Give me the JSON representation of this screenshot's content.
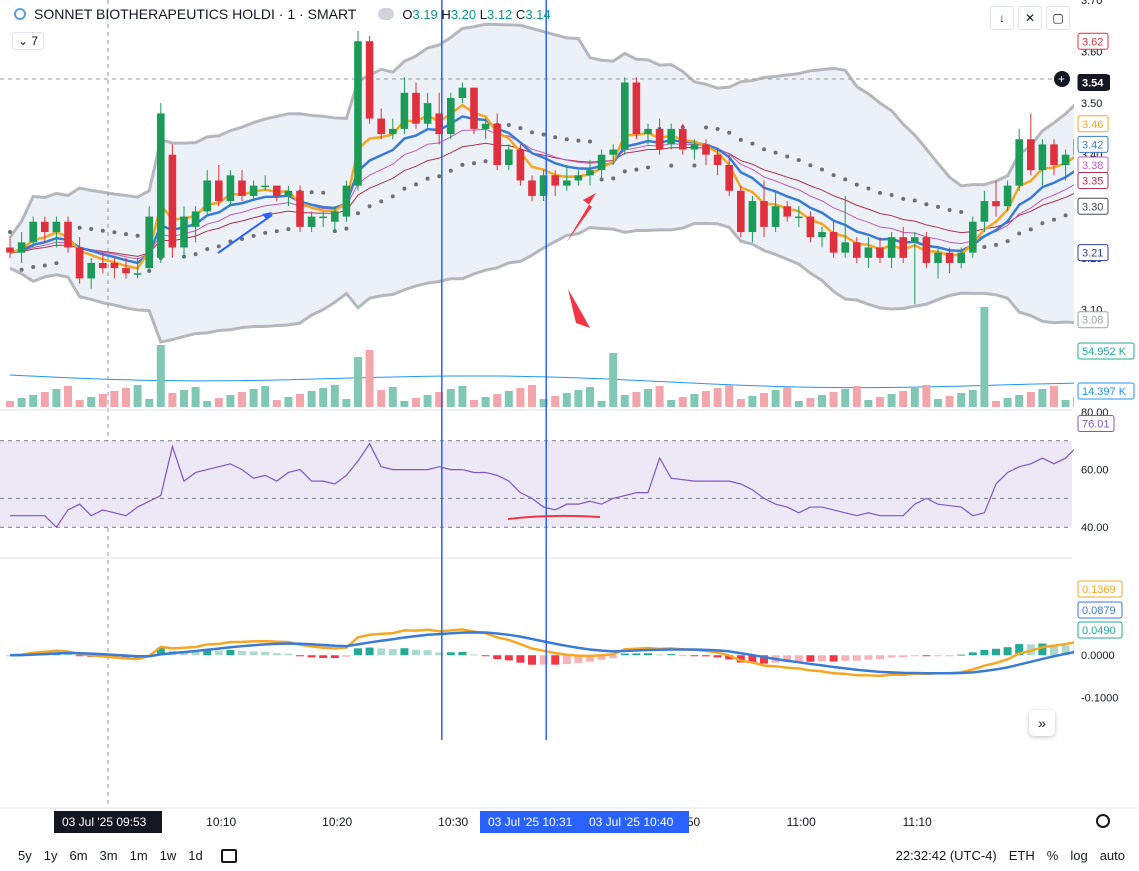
{
  "header": {
    "symbol": "SONNET BIOTHERAPEUTICS HOLDI",
    "interval": "1",
    "exchange": "SMART",
    "open_label": "O",
    "open": "3.19",
    "high_label": "H",
    "high": "3.20",
    "low_label": "L",
    "low": "3.12",
    "close_label": "C",
    "close": "3.14",
    "indicator_count": "7"
  },
  "toolbar": {
    "down_arrow_icon": "arrow-down-icon",
    "collapse_icon": "collapse-icon",
    "fullscreen_icon": "fullscreen-icon",
    "nav_icon": "double-chevron-right-icon"
  },
  "bottom_bar": {
    "ranges": [
      "5y",
      "1y",
      "6m",
      "3m",
      "1m",
      "1w",
      "1d"
    ],
    "time": "22:32:42 (UTC-4)",
    "session": "ETH",
    "percent": "%",
    "log": "log",
    "auto": "auto"
  },
  "chart_data": [
    {
      "type": "candlestick",
      "panel": "price",
      "ylim": [
        3.06,
        3.7
      ],
      "y_ticks": [
        "3.70",
        "3.60",
        "3.50",
        "3.40",
        "3.30",
        "3.20",
        "3.10"
      ],
      "x_ticks": [
        {
          "t": 7,
          "label": "10:00"
        },
        {
          "t": 17,
          "label": "10:10"
        },
        {
          "t": 27,
          "label": "10:20"
        },
        {
          "t": 37,
          "label": "10:30"
        },
        {
          "t": 47,
          "label": "10:40"
        },
        {
          "t": 57,
          "label": "10:50"
        },
        {
          "t": 67,
          "label": "11:00"
        },
        {
          "t": 77,
          "label": "11:10"
        }
      ],
      "x_highlights": [
        {
          "t": 0,
          "label": "03 Jul '25   09:53",
          "style": "dark"
        },
        {
          "t": 38,
          "label": "03 Jul '25   10:31",
          "style": "blue"
        },
        {
          "t": 47,
          "label": "03 Jul '25   10:40",
          "style": "blue"
        }
      ],
      "price_marker": {
        "value": 3.54,
        "label": "3.54"
      },
      "candles": [
        [
          3.22,
          3.24,
          3.2,
          3.21
        ],
        [
          3.21,
          3.25,
          3.19,
          3.23
        ],
        [
          3.23,
          3.28,
          3.22,
          3.27
        ],
        [
          3.27,
          3.28,
          3.23,
          3.25
        ],
        [
          3.25,
          3.28,
          3.22,
          3.27
        ],
        [
          3.27,
          3.28,
          3.21,
          3.22
        ],
        [
          3.22,
          3.24,
          3.15,
          3.16
        ],
        [
          3.16,
          3.2,
          3.14,
          3.19
        ],
        [
          3.19,
          3.21,
          3.17,
          3.18
        ],
        [
          3.19,
          3.2,
          3.16,
          3.18
        ],
        [
          3.18,
          3.2,
          3.16,
          3.17
        ],
        [
          3.17,
          3.2,
          3.16,
          3.17
        ],
        [
          3.18,
          3.3,
          3.17,
          3.28
        ],
        [
          3.2,
          3.5,
          3.19,
          3.48
        ],
        [
          3.4,
          3.42,
          3.2,
          3.22
        ],
        [
          3.22,
          3.3,
          3.2,
          3.28
        ],
        [
          3.26,
          3.3,
          3.23,
          3.29
        ],
        [
          3.29,
          3.37,
          3.28,
          3.35
        ],
        [
          3.35,
          3.38,
          3.3,
          3.31
        ],
        [
          3.31,
          3.37,
          3.3,
          3.36
        ],
        [
          3.35,
          3.37,
          3.31,
          3.32
        ],
        [
          3.32,
          3.35,
          3.31,
          3.34
        ],
        [
          3.34,
          3.36,
          3.33,
          3.34
        ],
        [
          3.34,
          3.34,
          3.31,
          3.32
        ],
        [
          3.32,
          3.34,
          3.3,
          3.33
        ],
        [
          3.33,
          3.34,
          3.25,
          3.26
        ],
        [
          3.26,
          3.29,
          3.25,
          3.28
        ],
        [
          3.28,
          3.29,
          3.26,
          3.28
        ],
        [
          3.27,
          3.3,
          3.25,
          3.29
        ],
        [
          3.28,
          3.35,
          3.27,
          3.34
        ],
        [
          3.34,
          3.64,
          3.33,
          3.62
        ],
        [
          3.62,
          3.63,
          3.46,
          3.47
        ],
        [
          3.47,
          3.49,
          3.43,
          3.44
        ],
        [
          3.44,
          3.47,
          3.43,
          3.45
        ],
        [
          3.45,
          3.55,
          3.44,
          3.52
        ],
        [
          3.52,
          3.54,
          3.45,
          3.46
        ],
        [
          3.46,
          3.52,
          3.45,
          3.5
        ],
        [
          3.48,
          3.52,
          3.42,
          3.44
        ],
        [
          3.44,
          3.52,
          3.43,
          3.51
        ],
        [
          3.51,
          3.54,
          3.5,
          3.53
        ],
        [
          3.53,
          3.53,
          3.44,
          3.45
        ],
        [
          3.45,
          3.47,
          3.43,
          3.46
        ],
        [
          3.46,
          3.48,
          3.37,
          3.38
        ],
        [
          3.38,
          3.42,
          3.37,
          3.41
        ],
        [
          3.41,
          3.42,
          3.34,
          3.35
        ],
        [
          3.35,
          3.36,
          3.31,
          3.32
        ],
        [
          3.32,
          3.37,
          3.31,
          3.36
        ],
        [
          3.36,
          3.37,
          3.32,
          3.34
        ],
        [
          3.34,
          3.38,
          3.33,
          3.35
        ],
        [
          3.35,
          3.37,
          3.34,
          3.36
        ],
        [
          3.36,
          3.39,
          3.34,
          3.37
        ],
        [
          3.37,
          3.41,
          3.35,
          3.4
        ],
        [
          3.4,
          3.42,
          3.38,
          3.41
        ],
        [
          3.41,
          3.55,
          3.4,
          3.54
        ],
        [
          3.54,
          3.55,
          3.43,
          3.44
        ],
        [
          3.44,
          3.46,
          3.42,
          3.45
        ],
        [
          3.45,
          3.47,
          3.4,
          3.41
        ],
        [
          3.42,
          3.46,
          3.41,
          3.45
        ],
        [
          3.45,
          3.46,
          3.4,
          3.41
        ],
        [
          3.41,
          3.43,
          3.39,
          3.42
        ],
        [
          3.42,
          3.43,
          3.38,
          3.4
        ],
        [
          3.4,
          3.41,
          3.36,
          3.38
        ],
        [
          3.38,
          3.4,
          3.32,
          3.33
        ],
        [
          3.33,
          3.34,
          3.24,
          3.25
        ],
        [
          3.25,
          3.32,
          3.23,
          3.31
        ],
        [
          3.31,
          3.35,
          3.24,
          3.26
        ],
        [
          3.26,
          3.33,
          3.25,
          3.3
        ],
        [
          3.3,
          3.31,
          3.27,
          3.28
        ],
        [
          3.28,
          3.3,
          3.26,
          3.28
        ],
        [
          3.28,
          3.29,
          3.23,
          3.24
        ],
        [
          3.24,
          3.26,
          3.22,
          3.25
        ],
        [
          3.25,
          3.27,
          3.2,
          3.21
        ],
        [
          3.21,
          3.32,
          3.2,
          3.23
        ],
        [
          3.23,
          3.24,
          3.19,
          3.2
        ],
        [
          3.2,
          3.24,
          3.18,
          3.22
        ],
        [
          3.22,
          3.24,
          3.19,
          3.2
        ],
        [
          3.2,
          3.25,
          3.18,
          3.24
        ],
        [
          3.24,
          3.26,
          3.19,
          3.2
        ],
        [
          3.23,
          3.25,
          3.11,
          3.24
        ],
        [
          3.24,
          3.25,
          3.18,
          3.19
        ],
        [
          3.19,
          3.22,
          3.16,
          3.21
        ],
        [
          3.21,
          3.22,
          3.17,
          3.19
        ],
        [
          3.19,
          3.22,
          3.18,
          3.21
        ],
        [
          3.21,
          3.28,
          3.2,
          3.27
        ],
        [
          3.27,
          3.33,
          3.25,
          3.31
        ],
        [
          3.31,
          3.35,
          3.28,
          3.3
        ],
        [
          3.3,
          3.35,
          3.29,
          3.34
        ],
        [
          3.34,
          3.45,
          3.33,
          3.43
        ],
        [
          3.43,
          3.48,
          3.36,
          3.37
        ],
        [
          3.37,
          3.43,
          3.34,
          3.42
        ],
        [
          3.42,
          3.43,
          3.36,
          3.38
        ],
        [
          3.38,
          3.41,
          3.35,
          3.4
        ],
        [
          3.4,
          3.44,
          3.39,
          3.43
        ],
        [
          3.42,
          3.66,
          3.41,
          3.62
        ]
      ],
      "bollinger": {
        "upper": 3.52,
        "lower": 3.14
      },
      "axis_labels": [
        {
          "value": 3.62,
          "label": "3.62",
          "color": "#e0303d"
        },
        {
          "value": 3.54,
          "label": "3.54",
          "color": "#131722"
        },
        {
          "value": 3.46,
          "label": "3.46",
          "color": "#f5a623"
        },
        {
          "value": 3.42,
          "label": "3.42",
          "color": "#3a7bd5"
        },
        {
          "value": 3.38,
          "label": "3.38",
          "color": "#c45bb5"
        },
        {
          "value": 3.35,
          "label": "3.35",
          "color": "#b0324f"
        },
        {
          "value": 3.3,
          "label": "3.30",
          "color": "#444a57"
        },
        {
          "value": 3.21,
          "label": "3.21",
          "color": "#2c3e9a"
        },
        {
          "value": 3.08,
          "label": "3.08",
          "color": "#9aa0a8"
        }
      ]
    },
    {
      "type": "bar",
      "panel": "volume",
      "labels": [
        {
          "label": "54.952 K",
          "color": "#22ab94"
        },
        {
          "label": "14.397 K",
          "color": "#2196f3"
        }
      ]
    },
    {
      "type": "line",
      "panel": "rsi",
      "ylim": [
        30,
        80
      ],
      "y_ticks": [
        "80.00",
        "60.00",
        "40.00"
      ],
      "band": [
        40,
        70
      ],
      "last_label": "76.01",
      "values": [
        44,
        44,
        44,
        44,
        40,
        46,
        48,
        44,
        46,
        45,
        44,
        47,
        51,
        68,
        56,
        59,
        60,
        61,
        62,
        60,
        57,
        58,
        56,
        59,
        60,
        56,
        56,
        55,
        58,
        63,
        69,
        61,
        60,
        60,
        60,
        61,
        60,
        60,
        59,
        59,
        58,
        56,
        52,
        50,
        47,
        46,
        48,
        48,
        49,
        48,
        50,
        51,
        52,
        52,
        64,
        57,
        56,
        56,
        56,
        56,
        55,
        53,
        50,
        48,
        47,
        45,
        47,
        47,
        46,
        45,
        44,
        45,
        44,
        44,
        44,
        48,
        50,
        48,
        47,
        44,
        45,
        55,
        59,
        61,
        62,
        64,
        62,
        64,
        68,
        76
      ]
    },
    {
      "type": "line",
      "panel": "macd",
      "ylim": [
        -0.2,
        0.22
      ],
      "y_ticks": [
        "0.0000",
        "-0.1000"
      ],
      "labels": [
        {
          "label": "0.1369",
          "color": "#f5a623"
        },
        {
          "label": "0.0879",
          "color": "#3a7bd5"
        },
        {
          "label": "0.0490",
          "color": "#22ab94"
        }
      ]
    }
  ]
}
